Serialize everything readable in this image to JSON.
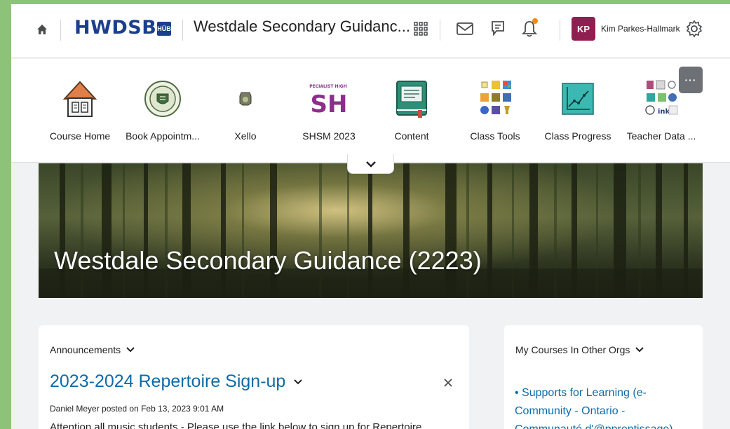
{
  "header": {
    "logo": "HWDSB",
    "logo_badge": "HÜB",
    "course_title": "Westdale Secondary Guidanc...",
    "user_initials": "KP",
    "user_name": "Kim Parkes-Hallmark",
    "avatar_color": "#8f1f50",
    "brand_color": "#1b3f8f",
    "notification_dot_color": "#f18a1c"
  },
  "nav": {
    "items": [
      {
        "label": "Course Home",
        "icon": "house-icon"
      },
      {
        "label": "Book Appointm...",
        "icon": "school-crest-icon"
      },
      {
        "label": "Xello",
        "icon": "xello-icon"
      },
      {
        "label": "SHSM 2023",
        "icon": "shsm-icon"
      },
      {
        "label": "Content",
        "icon": "book-icon"
      },
      {
        "label": "Class Tools",
        "icon": "tools-grid-icon"
      },
      {
        "label": "Class Progress",
        "icon": "progress-chart-icon"
      },
      {
        "label": "Teacher Data ...",
        "icon": "teacher-data-icon"
      }
    ],
    "more_label": "···"
  },
  "banner": {
    "title": "Westdale Secondary Guidance (2223)"
  },
  "announcements": {
    "heading": "Announcements",
    "title": "2023-2024 Repertoire Sign-up",
    "meta": "Daniel Meyer posted on Feb 13, 2023 9:01 AM",
    "body": "Attention all music students - Please use the link below to sign up for Repertoire"
  },
  "other_orgs": {
    "heading": "My Courses In Other Orgs",
    "link": "• Supports for Learning (e-Community - Ontario - Communauté d'@pprentissage)"
  },
  "link_color": "#0d6ba8"
}
